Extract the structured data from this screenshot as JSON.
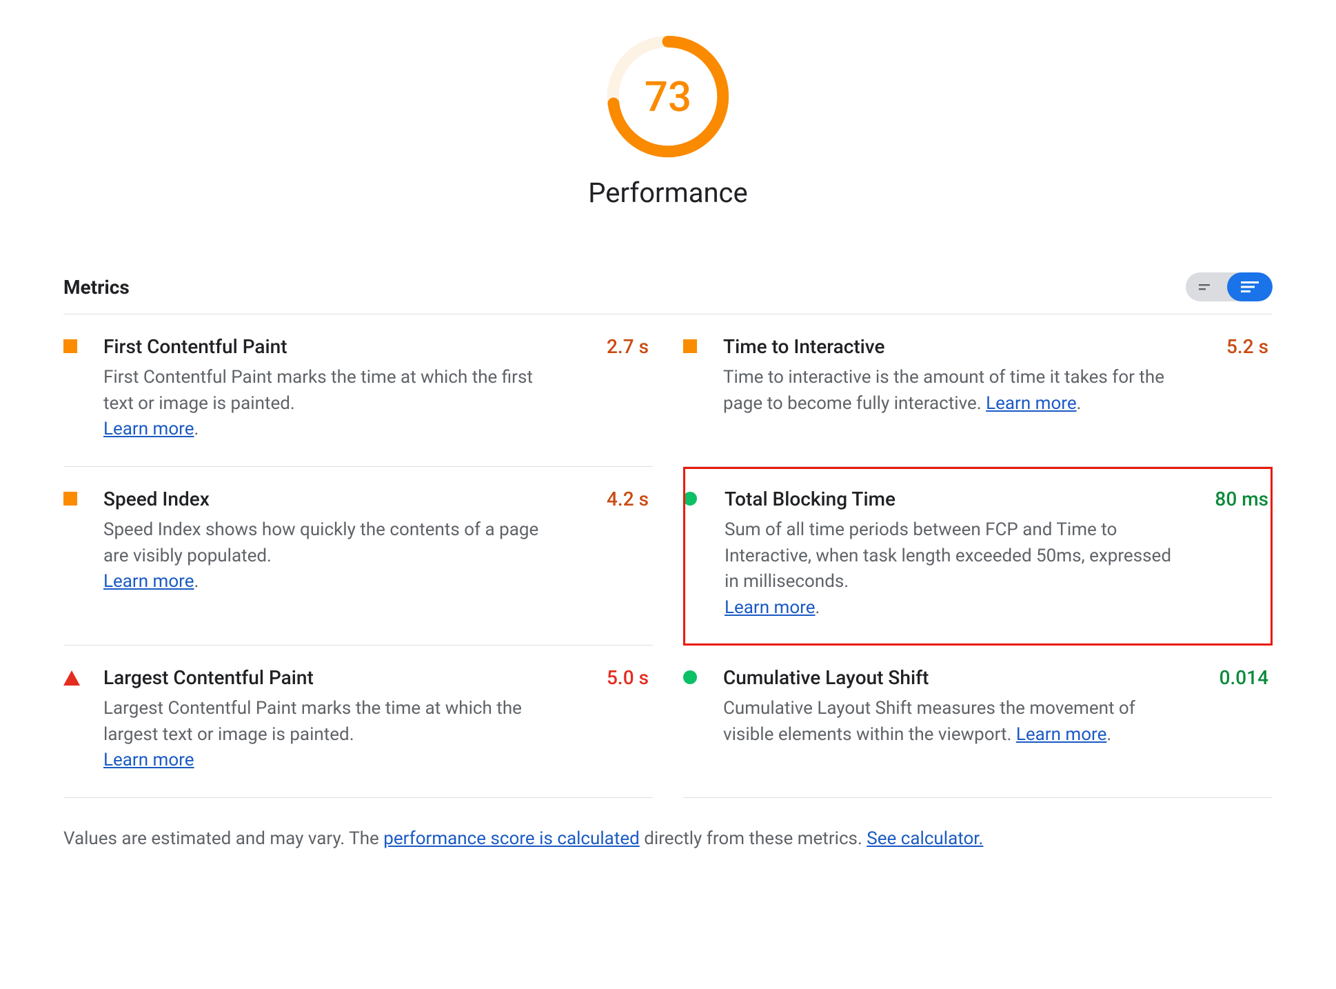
{
  "gauge": {
    "score": "73",
    "score_pct": 73,
    "label": "Performance",
    "color": "#fa8a00",
    "track_color": "#fdf3e5"
  },
  "metrics_header": "Metrics",
  "view_toggle": {
    "compact_active": false,
    "expanded_active": true
  },
  "learn_more_label": "Learn more",
  "metrics": [
    {
      "key": "fcp",
      "col": "left",
      "icon": "square-orange",
      "title": "First Contentful Paint",
      "desc_main": "First Contentful Paint marks the time at which the first text or image is painted. ",
      "learn_more_inline": false,
      "value": "2.7 s",
      "value_class": "orange"
    },
    {
      "key": "tti",
      "col": "right",
      "icon": "square-orange",
      "title": "Time to Interactive",
      "desc_main": "Time to interactive is the amount of time it takes for the page to become fully interactive. ",
      "learn_more_inline": true,
      "value": "5.2 s",
      "value_class": "orange"
    },
    {
      "key": "si",
      "col": "left",
      "icon": "square-orange",
      "title": "Speed Index",
      "desc_main": "Speed Index shows how quickly the contents of a page are visibly populated. ",
      "learn_more_inline": false,
      "value": "4.2 s",
      "value_class": "orange"
    },
    {
      "key": "tbt",
      "col": "right",
      "icon": "circle-green",
      "title": "Total Blocking Time",
      "desc_main": "Sum of all time periods between FCP and Time to Interactive, when task length exceeded 50ms, expressed in milliseconds. ",
      "learn_more_inline": false,
      "value": "80 ms",
      "value_class": "green",
      "highlight": true
    },
    {
      "key": "lcp",
      "col": "left",
      "icon": "triangle-red",
      "title": "Largest Contentful Paint",
      "desc_main": "Largest Contentful Paint marks the time at which the largest text or image is painted. ",
      "learn_more_inline": false,
      "learn_more_no_trail": true,
      "value": "5.0 s",
      "value_class": "red"
    },
    {
      "key": "cls",
      "col": "right",
      "icon": "circle-green",
      "title": "Cumulative Layout Shift",
      "desc_main": "Cumulative Layout Shift measures the movement of visible elements within the viewport. ",
      "learn_more_inline": true,
      "value": "0.014",
      "value_class": "green"
    }
  ],
  "footer": {
    "prefix": "Values are estimated and may vary. The ",
    "link1": "performance score is calculated",
    "middle": " directly from these metrics. ",
    "link2": "See calculator."
  }
}
